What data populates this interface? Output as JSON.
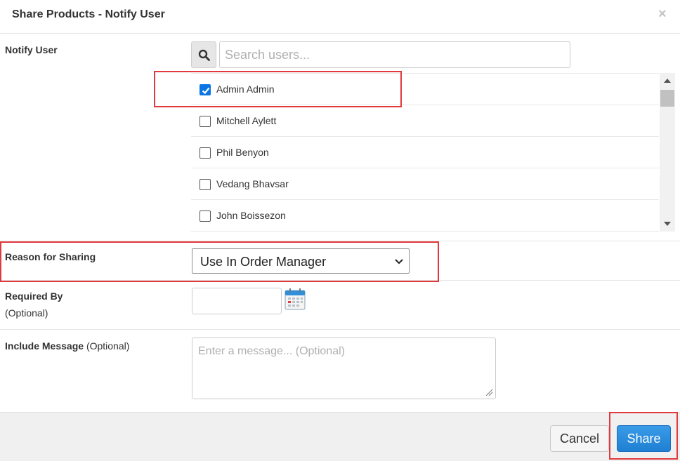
{
  "dialog": {
    "title": "Share Products - Notify User",
    "close_glyph": "×"
  },
  "notify_user": {
    "label": "Notify User",
    "search_icon": "search-icon",
    "search_placeholder": "Search users...",
    "users": [
      {
        "name": "Admin Admin",
        "checked": true
      },
      {
        "name": "Mitchell Aylett",
        "checked": false
      },
      {
        "name": "Phil Benyon",
        "checked": false
      },
      {
        "name": "Vedang Bhavsar",
        "checked": false
      },
      {
        "name": "John Boissezon",
        "checked": false
      }
    ]
  },
  "reason": {
    "label": "Reason for Sharing",
    "selected": "Use In Order Manager"
  },
  "required_by": {
    "label": "Required By",
    "optional": "(Optional)",
    "value": "",
    "icon": "calendar-icon"
  },
  "message": {
    "label": "Include Message",
    "optional": "(Optional)",
    "placeholder": "Enter a message... (Optional)"
  },
  "footer": {
    "cancel_label": "Cancel",
    "share_label": "Share"
  },
  "colors": {
    "accent": "#1f7fd2",
    "highlight": "#e0393e",
    "checkbox": "#0a75e3"
  }
}
